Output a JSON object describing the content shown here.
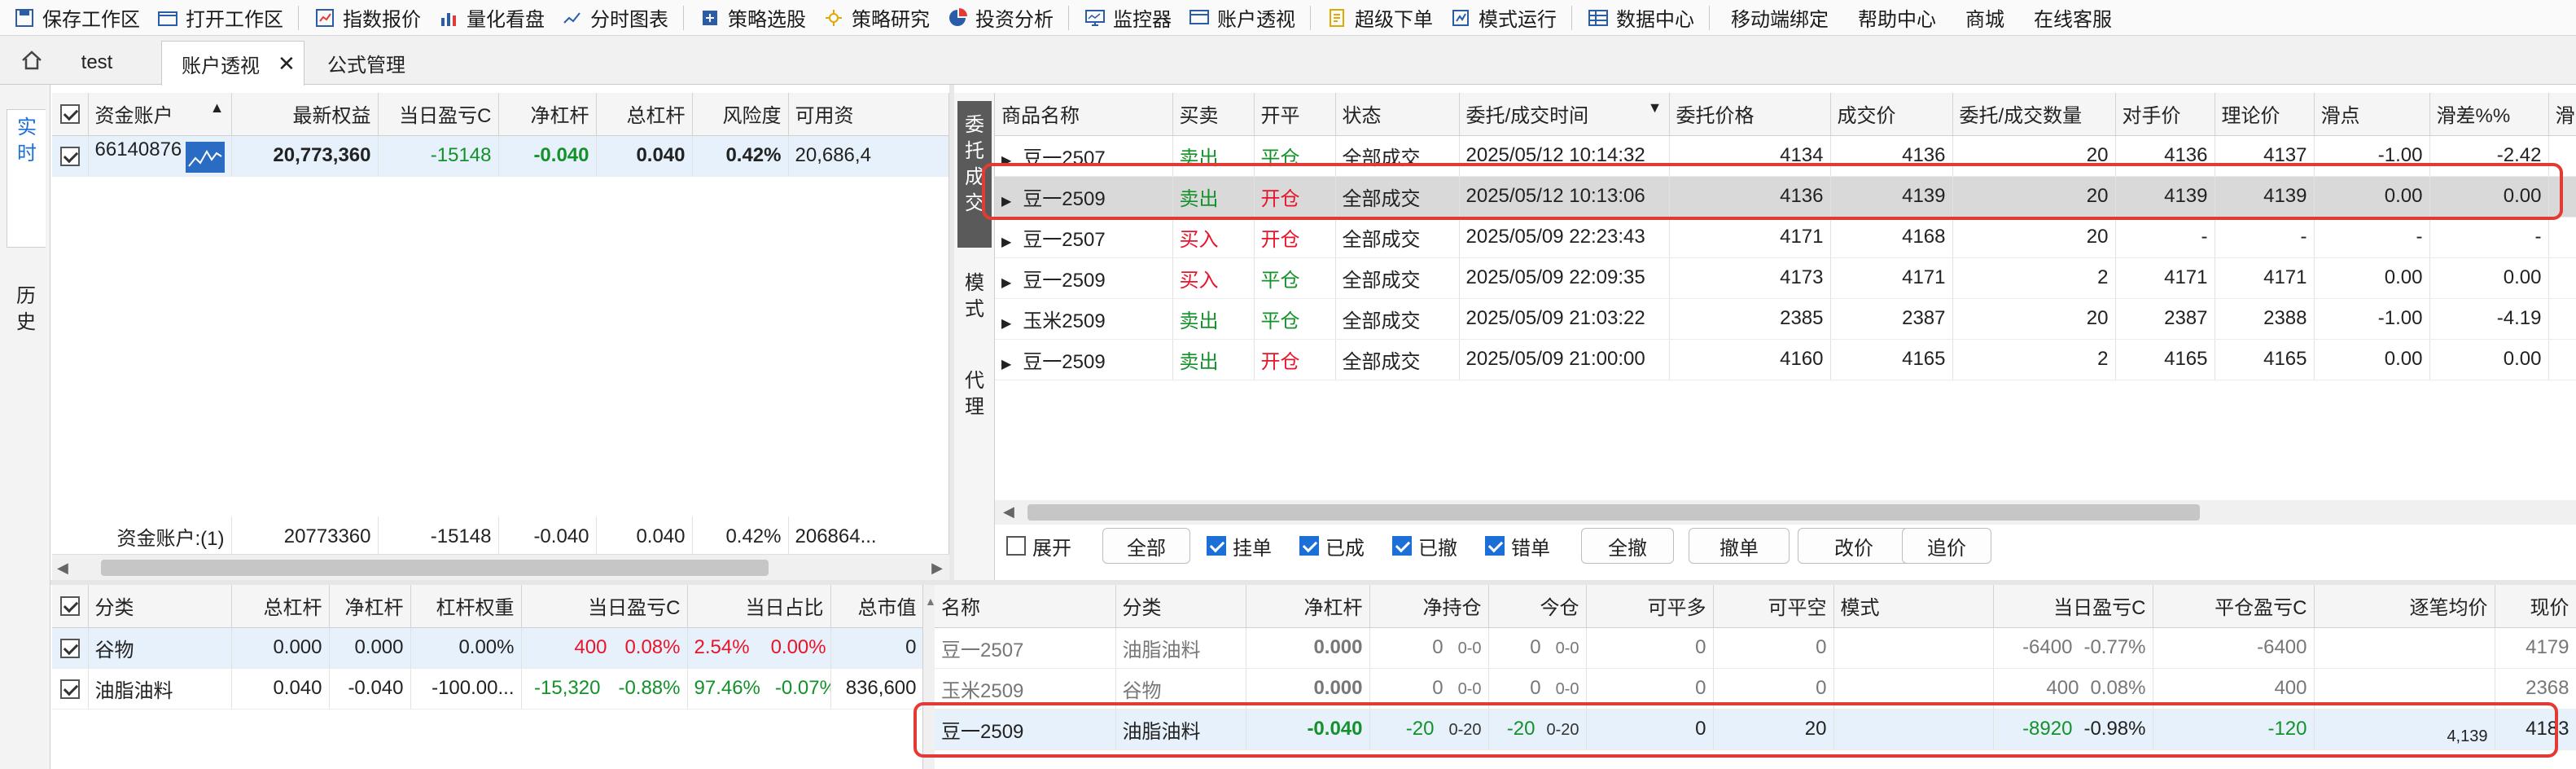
{
  "toolbar": [
    {
      "icon": "save-workspace-icon",
      "label": "保存工作区"
    },
    {
      "icon": "open-workspace-icon",
      "label": "打开工作区"
    },
    {
      "icon": "index-quote-icon",
      "label": "指数报价"
    },
    {
      "icon": "quant-board-icon",
      "label": "量化看盘"
    },
    {
      "icon": "timeshare-chart-icon",
      "label": "分时图表"
    },
    {
      "icon": "strategy-select-icon",
      "label": "策略选股"
    },
    {
      "icon": "strategy-research-icon",
      "label": "策略研究"
    },
    {
      "icon": "investment-analysis-icon",
      "label": "投资分析"
    },
    {
      "icon": "monitor-icon",
      "label": "监控器"
    },
    {
      "icon": "account-view-icon",
      "label": "账户透视"
    },
    {
      "icon": "super-order-icon",
      "label": "超级下单"
    },
    {
      "icon": "mode-run-icon",
      "label": "模式运行"
    },
    {
      "icon": "data-center-icon",
      "label": "数据中心"
    },
    {
      "icon": "",
      "label": "移动端绑定"
    },
    {
      "icon": "",
      "label": "帮助中心"
    },
    {
      "icon": "",
      "label": "商城"
    },
    {
      "icon": "",
      "label": "在线客服"
    }
  ],
  "tabs": {
    "home_icon": "home-icon",
    "items": [
      "test",
      "账户透视",
      "公式管理"
    ],
    "close": "✕"
  },
  "side_tabs": [
    "实时",
    "历史"
  ],
  "accounts": {
    "headers": [
      "资金账户",
      "最新权益",
      "当日盈亏C",
      "净杠杆",
      "总杠杆",
      "风险度",
      "可用资"
    ],
    "rows": [
      {
        "account": "66140876",
        "equity": "20,773,360",
        "pnl": "-15148",
        "net_lev": "-0.040",
        "total_lev": "0.040",
        "risk": "0.42%",
        "avail": "20,686,4"
      }
    ],
    "footer": {
      "label": "资金账户:(1)",
      "equity": "20773360",
      "pnl": "-15148",
      "net_lev": "-0.040",
      "total_lev": "0.040",
      "risk": "0.42%",
      "avail": "206864..."
    }
  },
  "orders": {
    "side_tabs": [
      "委托成交",
      "模式",
      "代理"
    ],
    "headers": [
      "商品名称",
      "买卖",
      "开平",
      "状态",
      "委托/成交时间",
      "委托价格",
      "成交价",
      "委托/成交数量",
      "对手价",
      "理论价",
      "滑点",
      "滑差%%",
      "滑"
    ],
    "rows": [
      {
        "name": "豆一2507",
        "side": "卖出",
        "oc": "平仓",
        "status": "全部成交",
        "time": "2025/05/12 10:14:32",
        "price": "4134",
        "fill": "4136",
        "qty": "20",
        "opp": "4136",
        "theo": "4137",
        "slip": "-1.00",
        "slip_pct": "-2.42"
      },
      {
        "name": "豆一2509",
        "side": "卖出",
        "oc": "开仓",
        "status": "全部成交",
        "time": "2025/05/12 10:13:06",
        "price": "4136",
        "fill": "4139",
        "qty": "20",
        "opp": "4139",
        "theo": "4139",
        "slip": "0.00",
        "slip_pct": "0.00"
      },
      {
        "name": "豆一2507",
        "side": "买入",
        "oc": "开仓",
        "status": "全部成交",
        "time": "2025/05/09 22:23:43",
        "price": "4171",
        "fill": "4168",
        "qty": "20",
        "opp": "-",
        "theo": "-",
        "slip": "-",
        "slip_pct": "-"
      },
      {
        "name": "豆一2509",
        "side": "买入",
        "oc": "平仓",
        "status": "全部成交",
        "time": "2025/05/09 22:09:35",
        "price": "4173",
        "fill": "4171",
        "qty": "2",
        "opp": "4171",
        "theo": "4171",
        "slip": "0.00",
        "slip_pct": "0.00"
      },
      {
        "name": "玉米2509",
        "side": "卖出",
        "oc": "平仓",
        "status": "全部成交",
        "time": "2025/05/09 21:03:22",
        "price": "2385",
        "fill": "2387",
        "qty": "20",
        "opp": "2387",
        "theo": "2388",
        "slip": "-1.00",
        "slip_pct": "-4.19"
      },
      {
        "name": "豆一2509",
        "side": "卖出",
        "oc": "开仓",
        "status": "全部成交",
        "time": "2025/05/09 21:00:00",
        "price": "4160",
        "fill": "4165",
        "qty": "2",
        "opp": "4165",
        "theo": "4165",
        "slip": "0.00",
        "slip_pct": "0.00"
      }
    ],
    "filters": {
      "expand": "展开",
      "all": "全部",
      "pending": "挂单",
      "filled": "已成",
      "cancelled": "已撤",
      "error": "错单",
      "cancel_all": "全撤",
      "cancel": "撤单",
      "modify": "改价",
      "chase": "追价"
    }
  },
  "categories": {
    "headers": [
      "分类",
      "总杠杆",
      "净杠杆",
      "杠杆权重",
      "当日盈亏C",
      "当日占比",
      "总市值"
    ],
    "rows": [
      {
        "name": "谷物",
        "total_lev": "0.000",
        "net_lev": "0.000",
        "weight": "0.00%",
        "pnl": "400",
        "pnl_pct": "0.08%",
        "share": "2.54%",
        "share_chg": "0.00%",
        "mv": "0"
      },
      {
        "name": "油脂油料",
        "total_lev": "0.040",
        "net_lev": "-0.040",
        "weight": "-100.00...",
        "pnl": "-15,320",
        "pnl_pct": "-0.88%",
        "share": "97.46%",
        "share_chg": "-0.07%",
        "mv": "836,600"
      }
    ]
  },
  "positions": {
    "headers": [
      "名称",
      "分类",
      "净杠杆",
      "净持仓",
      "今仓",
      "可平多",
      "可平空",
      "模式",
      "当日盈亏C",
      "平仓盈亏C",
      "逐笔均价",
      "现价"
    ],
    "rows": [
      {
        "name": "豆一2507",
        "cat": "油脂油料",
        "net_lev": "0.000",
        "net_pos": "0",
        "net_sub": "0-0",
        "today": "0",
        "today_sub": "0-0",
        "long": "0",
        "short": "0",
        "mode": "",
        "pnl": "-6400",
        "pnl_pct": "-0.77%",
        "close_pnl": "-6400",
        "avg": "",
        "last": "4179"
      },
      {
        "name": "玉米2509",
        "cat": "谷物",
        "net_lev": "0.000",
        "net_pos": "0",
        "net_sub": "0-0",
        "today": "0",
        "today_sub": "0-0",
        "long": "0",
        "short": "0",
        "mode": "",
        "pnl": "400",
        "pnl_pct": "0.08%",
        "close_pnl": "400",
        "avg": "",
        "last": "2368"
      },
      {
        "name": "豆一2509",
        "cat": "油脂油料",
        "net_lev": "-0.040",
        "net_pos": "-20",
        "net_sub": "0-20",
        "today": "-20",
        "today_sub": "0-20",
        "long": "0",
        "short": "20",
        "mode": "",
        "pnl": "-8920",
        "pnl_pct": "-0.98%",
        "close_pnl": "-120",
        "avg": "4,139",
        "last": "4183"
      }
    ]
  },
  "colors": {
    "highlight": "#e23b35",
    "buy": "#e8142a",
    "sell": "#14912a",
    "accent": "#1c6fd6"
  }
}
